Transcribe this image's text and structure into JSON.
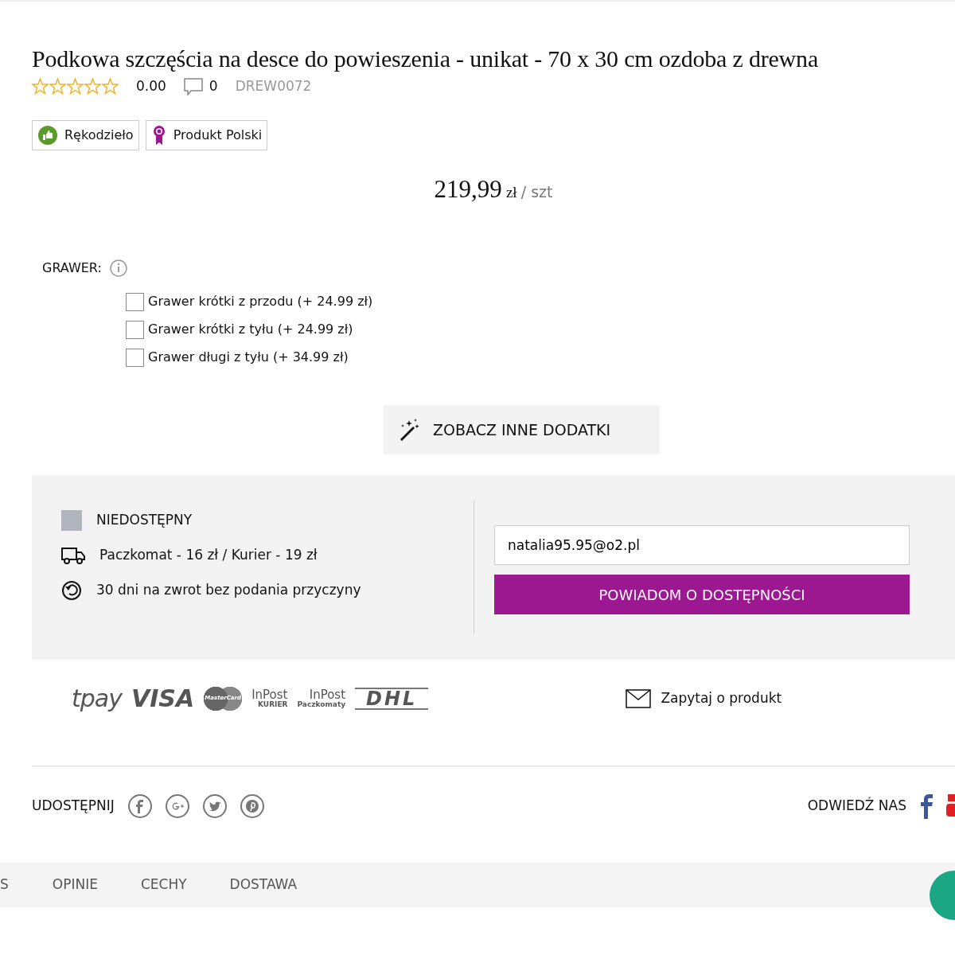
{
  "product": {
    "title": "Podkowa szczęścia na desce do powieszenia - unikat - 70 x 30 cm ozdoba z drewna",
    "stars": 0,
    "rating": "0.00",
    "comments": "0",
    "code": "DREW0072"
  },
  "badges": [
    {
      "kind": "handmade",
      "label": "Rękodzieło"
    },
    {
      "kind": "polish",
      "label": "Produkt Polski"
    }
  ],
  "price": {
    "amount": "219,99",
    "currency": "zł",
    "unit": "/ szt"
  },
  "engraving": {
    "label": "GRAWER:",
    "options": [
      {
        "label": "Grawer krótki z przodu (+ 24.99 zł)",
        "checked": false
      },
      {
        "label": "Grawer krótki z tyłu (+ 24.99 zł)",
        "checked": false
      },
      {
        "label": "Grawer długi z tyłu (+ 34.99 zł)",
        "checked": false
      }
    ]
  },
  "addons_button": "ZOBACZ INNE DODATKI",
  "availability": {
    "status": "NIEDOSTĘPNY",
    "shipping": "Paczkomat - 16 zł / Kurier - 19 zł",
    "returns": "30 dni na zwrot bez podania przyczyny"
  },
  "notify": {
    "email": "natalia95.95@o2.pl",
    "button": "POWIADOM O DOSTĘPNOŚCI"
  },
  "logos": [
    {
      "kind": "tpay",
      "text": "tpay"
    },
    {
      "kind": "visa",
      "text": "VISA"
    },
    {
      "kind": "mastercard",
      "text": "MasterCard"
    },
    {
      "kind": "inpost",
      "text": "InPost",
      "sub": "KURIER"
    },
    {
      "kind": "inpost",
      "text": "InPost",
      "sub": "Paczkomaty"
    },
    {
      "kind": "dhl",
      "text": "DHL"
    }
  ],
  "ask_link": "Zapytaj o produkt",
  "share": {
    "label": "UDOSTĘPNIJ",
    "icons": [
      {
        "kind": "facebook"
      },
      {
        "kind": "google"
      },
      {
        "kind": "twitter"
      },
      {
        "kind": "pinterest"
      }
    ]
  },
  "visit": {
    "label": "ODWIEDŹ NAS"
  },
  "tabs": [
    {
      "label": "S",
      "selected": false
    },
    {
      "label": "OPINIE",
      "selected": false
    },
    {
      "label": "CECHY",
      "selected": false
    },
    {
      "label": "DOSTAWA",
      "selected": false
    }
  ]
}
